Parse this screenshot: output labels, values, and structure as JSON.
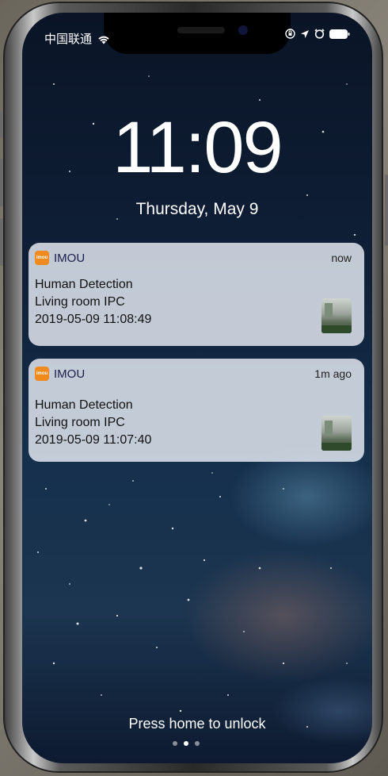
{
  "status_bar": {
    "carrier": "中国联通",
    "icons": [
      "wifi-icon",
      "screen-rotation-lock-icon",
      "location-icon",
      "alarm-icon",
      "battery-icon"
    ]
  },
  "lock_screen": {
    "time": "11:09",
    "date": "Thursday, May 9",
    "unlock_hint": "Press home to unlock"
  },
  "notifications": [
    {
      "app": "IMOU",
      "app_icon_text": "imou",
      "time": "now",
      "title": "Human Detection",
      "device": "Living room IPC",
      "timestamp": "2019-05-09 11:08:49"
    },
    {
      "app": "IMOU",
      "app_icon_text": "imou",
      "time": "1m ago",
      "title": "Human Detection",
      "device": "Living room IPC",
      "timestamp": "2019-05-09 11:07:40"
    }
  ],
  "colors": {
    "imou_brand": "#f08a1c",
    "notification_bg": "#dce1eb"
  }
}
